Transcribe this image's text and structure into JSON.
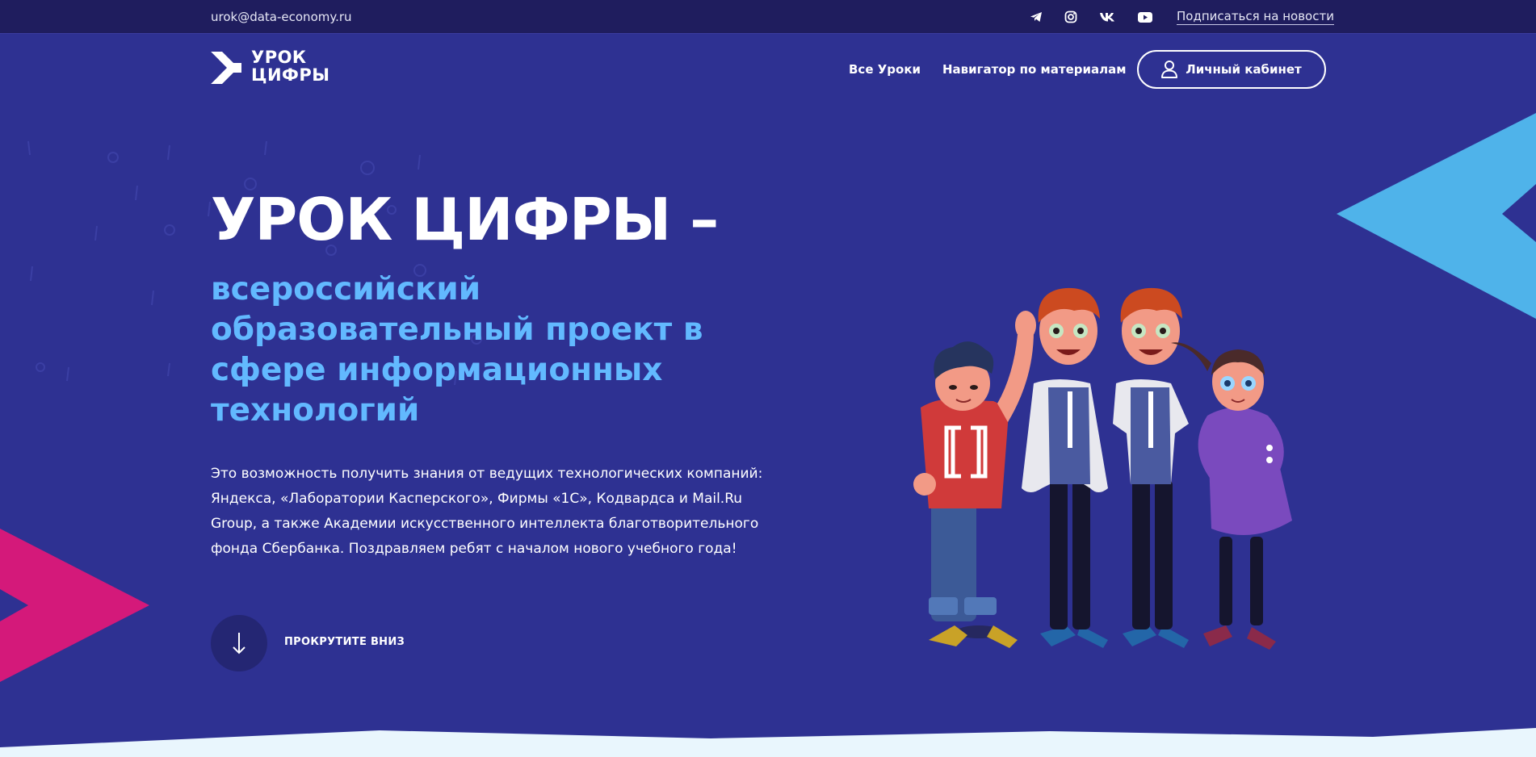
{
  "topbar": {
    "email": "urok@data-economy.ru",
    "social_icons": [
      "telegram-icon",
      "instagram-icon",
      "vk-icon",
      "youtube-icon"
    ],
    "subscribe_label": "Подписаться на новости"
  },
  "nav": {
    "logo_line1": "УРОК",
    "logo_line2": "ЦИФРЫ",
    "links": [
      "Все Уроки",
      "Навигатор по материалам"
    ],
    "cabinet_label": "Личный кабинет"
  },
  "hero": {
    "title": "УРОК ЦИФРЫ –",
    "subtitle": "всероссийский образовательный проект в сфере информационных технологий",
    "description": "Это возможность получить знания от ведущих технологических компаний: Яндекса, «Лаборатории Касперского», Фирмы «1С», Кодвардса и Mail.Ru Group, а также Академии искусственного интеллекта благотворительного фонда Сбербанка. Поздравляем ребят с началом нового учебного года!",
    "scroll_label": "ПРОКРУТИТЕ ВНИЗ"
  },
  "colors": {
    "background": "#2e3192",
    "topbar": "#1f1d5e",
    "accent_blue": "#62b9ff",
    "accent_pink": "#d4197a",
    "triangle_blue": "#4fb3ea"
  }
}
